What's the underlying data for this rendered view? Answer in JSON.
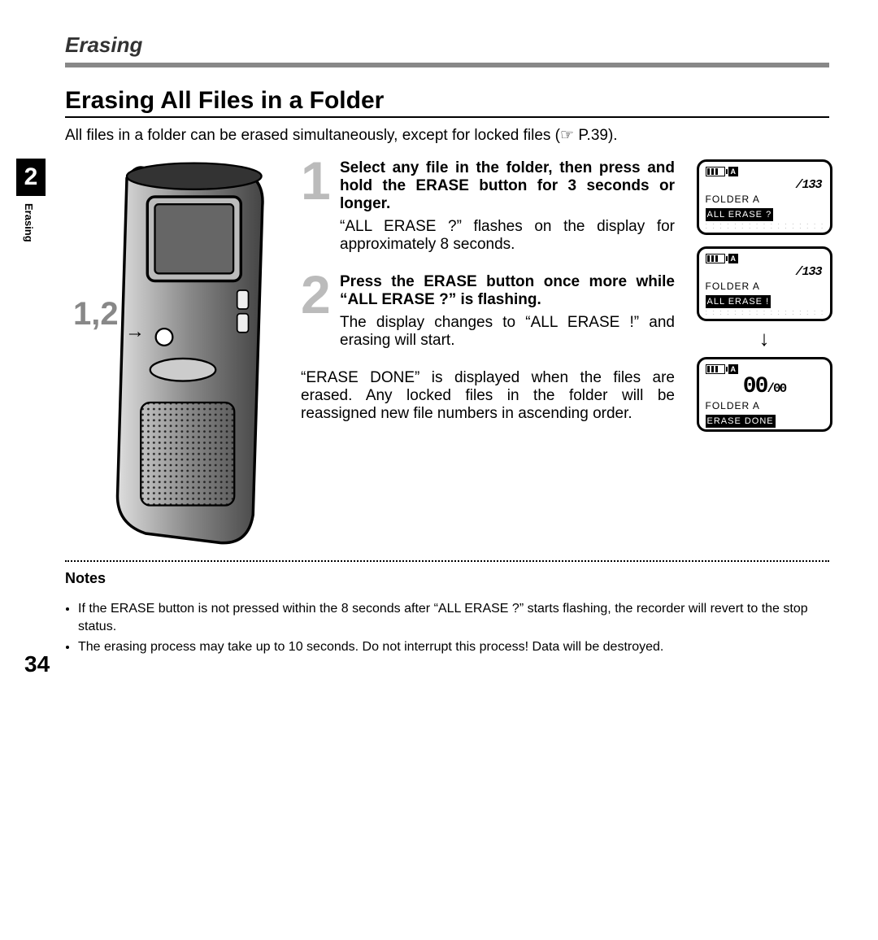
{
  "sectionHeader": "Erasing",
  "subtitle": "Erasing All Files in a Folder",
  "introPrefix": "All files in a folder can be erased simultaneously, except for locked files (",
  "introRef": "☞ P.39",
  "introSuffix": ").",
  "chapterTab": "2",
  "chapterLabel": "Erasing",
  "calloutLabel": "1,2",
  "steps": [
    {
      "num": "1",
      "title_before": "Select any file in the folder, then press and hold the ",
      "title_bold": "ERASE",
      "title_after": " button for 3 seconds or longer.",
      "desc": "“ALL ERASE ?” flashes on the display for approximately 8 seconds."
    },
    {
      "num": "2",
      "title_before": "Press the ",
      "title_bold": "ERASE",
      "title_after": " button once more while “ALL ERASE ?” is flashing.",
      "desc": "The display changes to “ALL ERASE !” and erasing will start."
    }
  ],
  "paraResult": "“ERASE DONE” is displayed when the files are erased. Any locked files in the folder will be reassigned new file numbers in ascending order.",
  "lcd": {
    "folderA": "A",
    "count133": "/133",
    "folderLine": "FOLDER  A",
    "msg1": "ALL ERASE ?",
    "msg2": "ALL ERASE !",
    "zeroBig": "00",
    "zeroSmall": "/00",
    "msg3": "ERASE DONE"
  },
  "notesHeading": "Notes",
  "notes": [
    "If the ERASE button is not pressed within the 8 seconds after “ALL ERASE ?” starts flashing, the recorder will revert to the stop status.",
    "The erasing process may take up to 10 seconds. Do not interrupt this process! Data will be destroyed."
  ],
  "pageNumber": "34"
}
